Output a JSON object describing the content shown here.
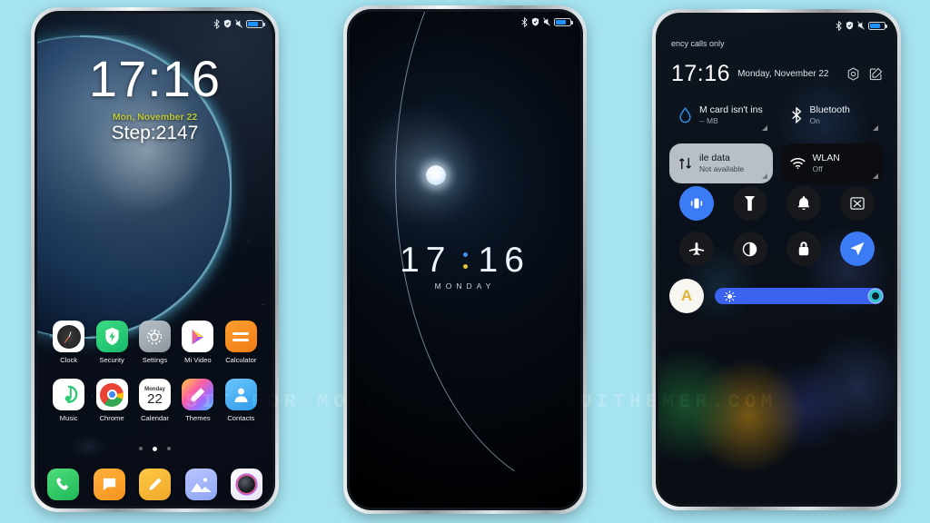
{
  "page": {
    "background_color": "#a5e3f0",
    "watermark": "VISIT FOR MORE THEMES - MIUITHEMER.COM"
  },
  "phone1": {
    "name": "lockscreen-home",
    "statusbar": {
      "icons": [
        "bluetooth-icon",
        "security-shield-icon",
        "mute-icon",
        "battery-icon"
      ]
    },
    "clock": "17:16",
    "date": "Mon, November 22",
    "date_color": "#b8c93b",
    "step_counter": "Step:2147",
    "apps_row1": [
      {
        "label": "Clock",
        "icon": "clock-app-icon"
      },
      {
        "label": "Security",
        "icon": "security-app-icon"
      },
      {
        "label": "Settings",
        "icon": "settings-app-icon"
      },
      {
        "label": "Mi Video",
        "icon": "mi-video-app-icon"
      },
      {
        "label": "Calculator",
        "icon": "calculator-app-icon"
      }
    ],
    "apps_row2": [
      {
        "label": "Music",
        "icon": "music-app-icon"
      },
      {
        "label": "Chrome",
        "icon": "chrome-app-icon"
      },
      {
        "label": "Calendar",
        "icon": "calendar-app-icon",
        "day_name": "Monday",
        "day_num": "22"
      },
      {
        "label": "Themes",
        "icon": "themes-app-icon"
      },
      {
        "label": "Contacts",
        "icon": "contacts-app-icon"
      }
    ],
    "page_dots": {
      "count": 3,
      "active_index": 1
    },
    "dock": [
      {
        "label": "Phone",
        "icon": "phone-app-icon"
      },
      {
        "label": "Messages",
        "icon": "messages-app-icon"
      },
      {
        "label": "Notes",
        "icon": "notes-app-icon"
      },
      {
        "label": "Gallery",
        "icon": "gallery-app-icon"
      },
      {
        "label": "Camera",
        "icon": "camera-app-icon"
      }
    ]
  },
  "phone2": {
    "name": "moon-lockscreen",
    "statusbar": {
      "icons": [
        "bluetooth-icon",
        "security-shield-icon",
        "mute-icon",
        "battery-icon"
      ]
    },
    "hours": "17",
    "minutes": "16",
    "colon_top_color": "#4a8ef0",
    "colon_bottom_color": "#e3c53a",
    "day": "MONDAY"
  },
  "phone3": {
    "name": "control-center",
    "carrier": "ency calls only",
    "statusbar": {
      "icons": [
        "bluetooth-icon",
        "security-shield-icon",
        "mute-icon",
        "battery-icon"
      ]
    },
    "time": "17:16",
    "date": "Monday, November 22",
    "header_icons": [
      "settings-gear-icon",
      "edit-icon"
    ],
    "tiles": [
      {
        "title": "M card isn't ins",
        "subtitle": "-- MB",
        "icon": "data-drop-icon",
        "style": "plain"
      },
      {
        "title": "Bluetooth",
        "subtitle": "On",
        "icon": "bluetooth-icon",
        "style": "plain"
      },
      {
        "title": "ile data",
        "subtitle": "Not available",
        "icon": "mobile-data-icon",
        "style": "light"
      },
      {
        "title": "WLAN",
        "subtitle": "Off",
        "icon": "wifi-icon",
        "style": "dark"
      }
    ],
    "toggles": [
      {
        "name": "vibrate-toggle",
        "icon": "vibrate-icon",
        "active": true
      },
      {
        "name": "flashlight-toggle",
        "icon": "flashlight-icon",
        "active": false
      },
      {
        "name": "ringer-toggle",
        "icon": "bell-icon",
        "active": false
      },
      {
        "name": "screenshot-toggle",
        "icon": "screenshot-icon",
        "active": false
      },
      {
        "name": "airplane-toggle",
        "icon": "airplane-icon",
        "active": false
      },
      {
        "name": "darkmode-toggle",
        "icon": "contrast-icon",
        "active": false
      },
      {
        "name": "lock-toggle",
        "icon": "lock-icon",
        "active": false
      },
      {
        "name": "location-toggle",
        "icon": "location-icon",
        "active": true
      }
    ],
    "auto_brightness_label": "A",
    "brightness_percent": 92,
    "accent_color": "#3b7cf6"
  }
}
